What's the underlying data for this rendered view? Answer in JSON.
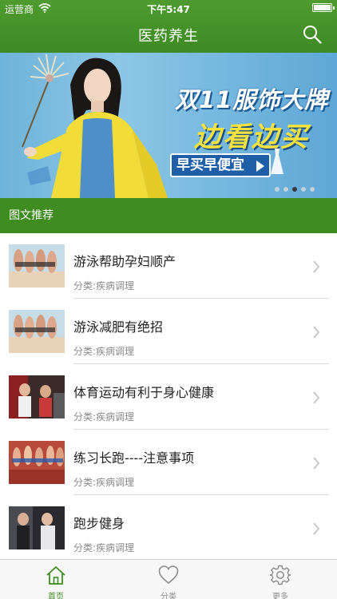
{
  "status_bar": {
    "carrier": "运营商",
    "time": "下午5:47"
  },
  "nav": {
    "title": "医药养生",
    "search_icon": "search-icon"
  },
  "banner": {
    "headline": "双11服饰大牌",
    "subhead": "边看边买",
    "cta": "早买早便宜",
    "page_count": 5,
    "active_page": 3
  },
  "section": {
    "title": "图文推荐"
  },
  "articles": [
    {
      "title": "游泳帮助孕妇顺产",
      "category": "分类:疾病调理"
    },
    {
      "title": "游泳减肥有绝招",
      "category": "分类:疾病调理"
    },
    {
      "title": "体育运动有利于身心健康",
      "category": "分类:疾病调理"
    },
    {
      "title": "练习长跑----注意事项",
      "category": "分类:疾病调理"
    },
    {
      "title": "跑步健身",
      "category": "分类:疾病调理"
    }
  ],
  "tabbar": {
    "home": {
      "label": "首页",
      "icon": "home-icon"
    },
    "category": {
      "label": "分类",
      "icon": "heart-icon"
    },
    "more": {
      "label": "更多",
      "icon": "gear-icon"
    }
  },
  "colors": {
    "brand_green": "#3f8c20",
    "header_green": "#4e9b2f",
    "banner_blue": "#6eb3d9",
    "banner_yellow": "#f6e23c"
  }
}
